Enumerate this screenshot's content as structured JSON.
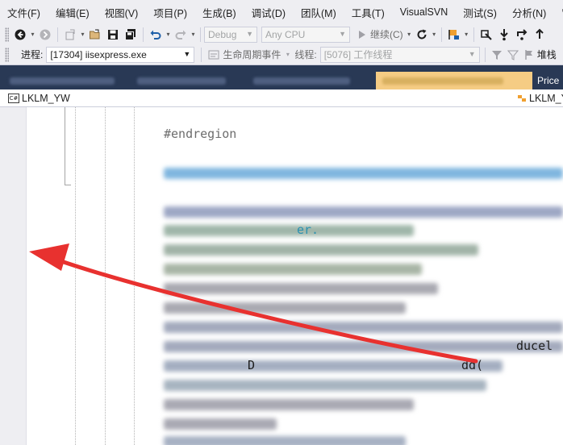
{
  "menu": {
    "items": [
      "文件(F)",
      "编辑(E)",
      "视图(V)",
      "项目(P)",
      "生成(B)",
      "调试(D)",
      "团队(M)",
      "工具(T)",
      "VisualSVN",
      "测试(S)",
      "分析(N)",
      "窗"
    ]
  },
  "toolbar": {
    "config_value": "Debug",
    "platform_value": "Any CPU",
    "continue_label": "继续(C)"
  },
  "debug_bar": {
    "process_label": "进程:",
    "process_value": "[17304] iisexpress.exe",
    "lifecycle_label": "生命周期事件",
    "thread_label": "线程:",
    "thread_value": "[5076] 工作线程",
    "stack_label": "堆栈"
  },
  "tabs": {
    "right_tab_label": "Price"
  },
  "navbar": {
    "badge": "C#",
    "project_name": "LKLM_YW",
    "right_project_name": "LKLM_Y"
  },
  "editor": {
    "region_text": "#endregion",
    "fragment_1": "er.",
    "fragment_2": "D",
    "fragment_3": "ducel",
    "fragment_4": "dd("
  },
  "colors": {
    "accent_tab": "#f5cc84",
    "tab_strip": "#293955",
    "annotation_arrow": "#e8312f"
  }
}
